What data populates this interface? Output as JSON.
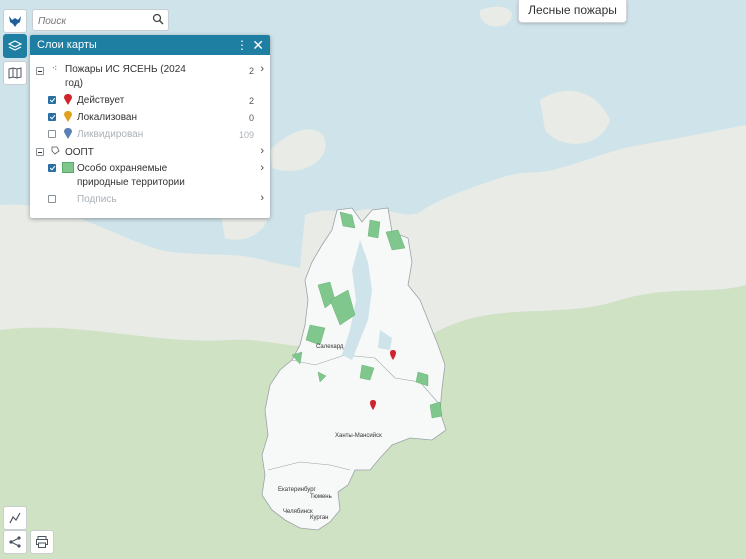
{
  "search": {
    "placeholder": "Поиск"
  },
  "top_button": {
    "label": "Лесные пожары"
  },
  "layers_panel": {
    "title": "Слои карты",
    "groups": [
      {
        "label_line1": "Пожары ИС ЯСЕНЬ (2024",
        "label_line2": "год)",
        "count": "2",
        "items": [
          {
            "label": "Действует",
            "count": "2",
            "checked": true,
            "color": "#d0232b"
          },
          {
            "label": "Локализован",
            "count": "0",
            "checked": true,
            "color": "#e0a21b"
          },
          {
            "label": "Ликвидирован",
            "count": "109",
            "checked": false,
            "color": "#5a7fb3"
          }
        ]
      },
      {
        "label": "ООПТ",
        "items": [
          {
            "label_line1": "Особо охраняемые",
            "label_line2": "природные территории",
            "checked": true,
            "color": "#6cbf7a"
          },
          {
            "label": "Подпись",
            "checked": false
          }
        ]
      }
    ]
  },
  "map": {
    "cities": [
      "Салехард",
      "Ханты-Мансийск",
      "Екатеринбург",
      "Тюмень",
      "Челябинск",
      "Курган"
    ],
    "fire_markers": 2,
    "colors": {
      "water": "#cfe4ea",
      "tundra": "#e9ece8",
      "forest": "#cfe2c4",
      "region": "#f7f8f8",
      "protected": "#7fc78c",
      "marker": "#d0232b",
      "accent": "#1f7fa3"
    }
  },
  "tools": {
    "logo_icon": "double-headed-eagle-icon",
    "layers_icon": "layers-icon",
    "basemap_icon": "map-icon",
    "draw_icon": "draw-icon",
    "share_icon": "share-icon",
    "print_icon": "print-icon"
  }
}
